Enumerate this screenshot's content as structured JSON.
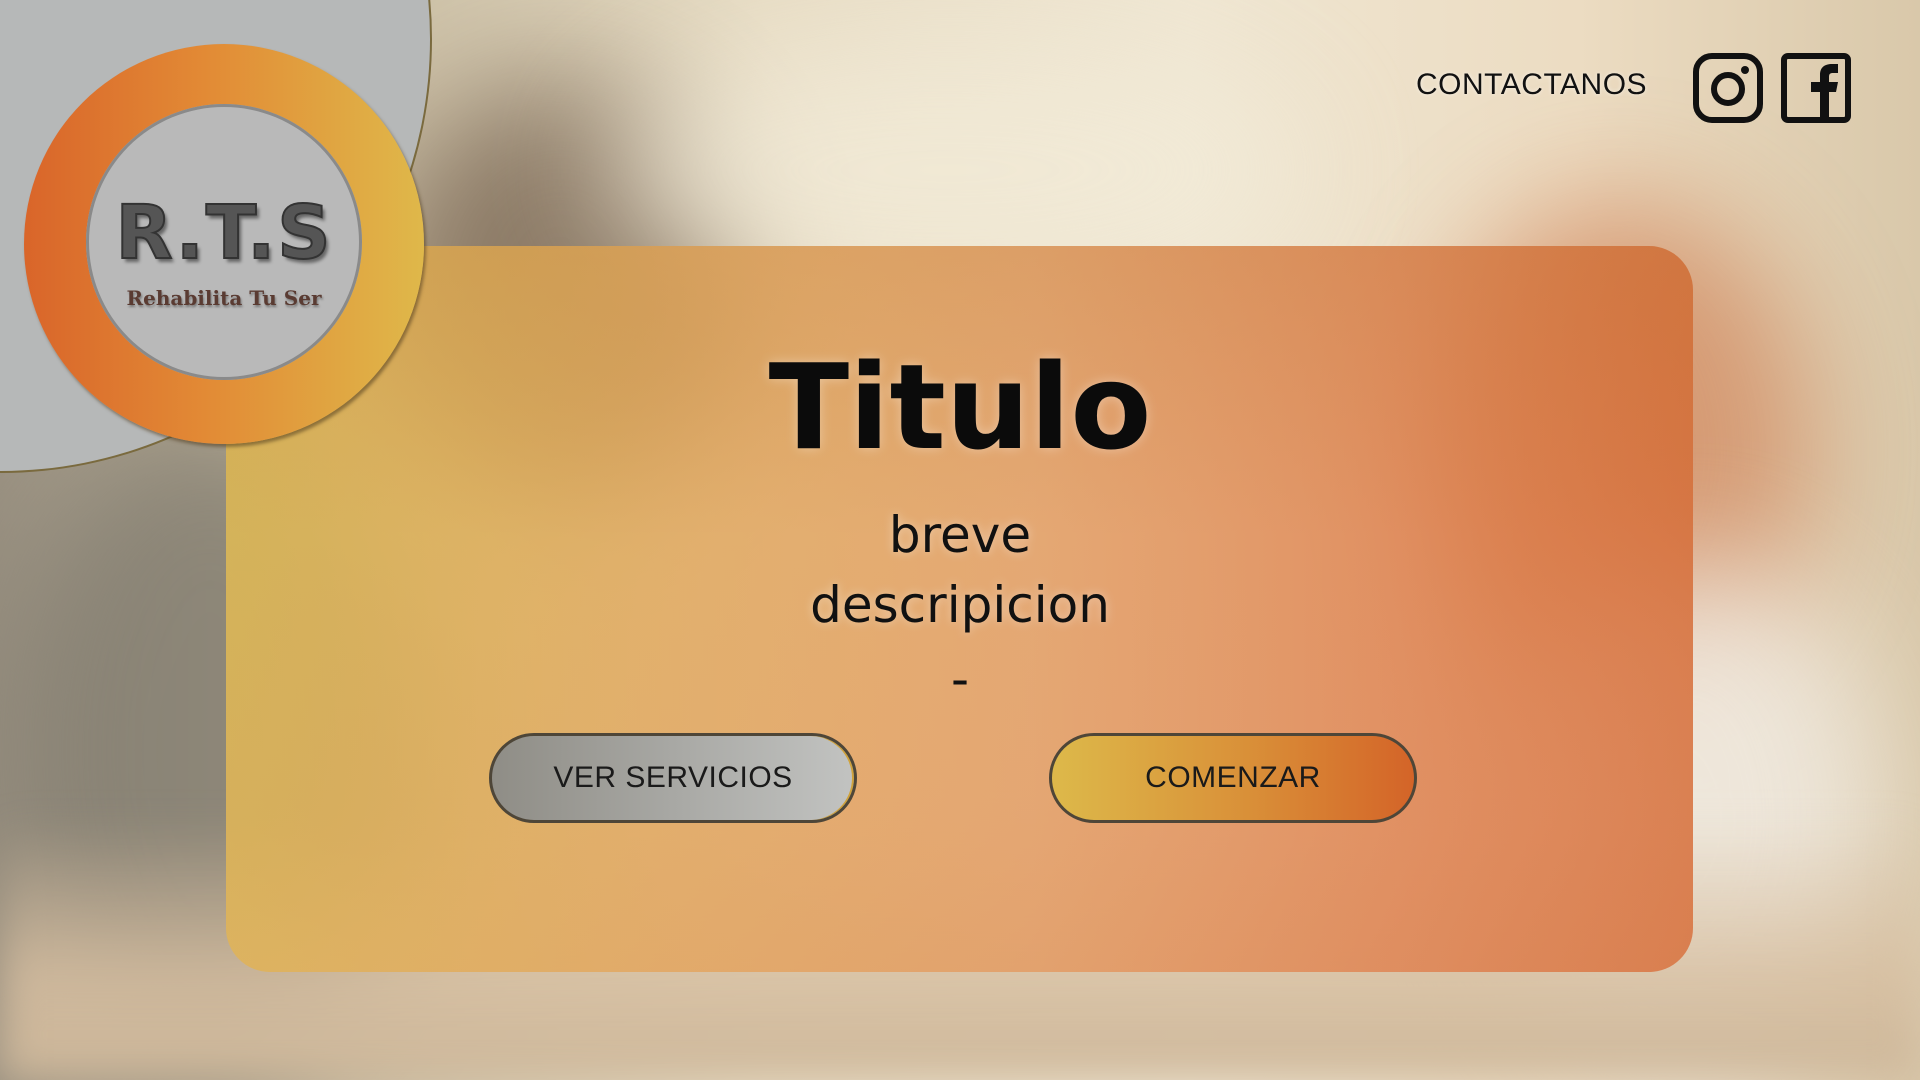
{
  "logo": {
    "mark": "R.T.S",
    "tagline": "Rehabilita Tu Ser"
  },
  "header": {
    "contact_label": "CONTACTANOS",
    "social_icons": [
      "instagram-icon",
      "facebook-icon"
    ]
  },
  "hero": {
    "title": "Titulo",
    "description_line1": "breve",
    "description_line2": "descripicion",
    "dash": "-"
  },
  "buttons": {
    "services_label": "VER SERVICIOS",
    "start_label": "COMENZAR"
  },
  "colors": {
    "accent_orange": "#d9652a",
    "accent_gold": "#dfb84a",
    "gray": "#b6b8b8",
    "text_dark": "#0b0b0b"
  }
}
